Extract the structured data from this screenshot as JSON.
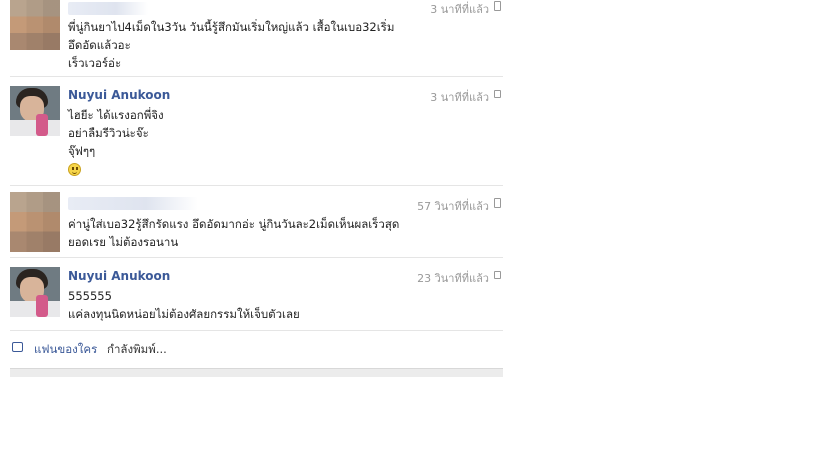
{
  "messages": [
    {
      "name": "",
      "time": "3 นาทีที่แล้ว",
      "via": "mobile",
      "lines": [
        "พี่นู่กินยาไป4เม็ดใน3วัน วันนี้รู้สึกมันเริ่มใหญ่แล้ว เสื้อในเบอ32เริ่ม",
        "อึดอัดแล้วอะ",
        "เร็วเวอร์อ่ะ"
      ]
    },
    {
      "name": "Nuyui Anukoon",
      "time": "3 นาทีที่แล้ว",
      "via": "chat",
      "lines": [
        "ไฮยีะ ได้แรงอกพี่จิง",
        "อย่าลืมรีวิวน่ะจ๊ะ",
        "จุ๊ฟๆๆ"
      ],
      "emoji": "smile"
    },
    {
      "name": "",
      "time": "57 วินาทีที่แล้ว",
      "via": "mobile",
      "lines": [
        "ค่านู่ใส่เบอ32รู้สึกรัดแรง อึดอัดมากอ่ะ นู่กินวันละ2เม็ดเห็นผลเร็วสุด",
        "ยอดเรย ไม่ต้องรอนาน"
      ]
    },
    {
      "name": "Nuyui Anukoon",
      "time": "23 วินาทีที่แล้ว",
      "via": "chat",
      "lines": [
        "555555",
        "แค่ลงทุนนิดหน่อยไม่ต้องศัลยกรรมให้เจ็บตัวเลย"
      ]
    }
  ],
  "typing": {
    "who": "แฟนของใคร",
    "rest": "กำลังพิมพ์..."
  }
}
